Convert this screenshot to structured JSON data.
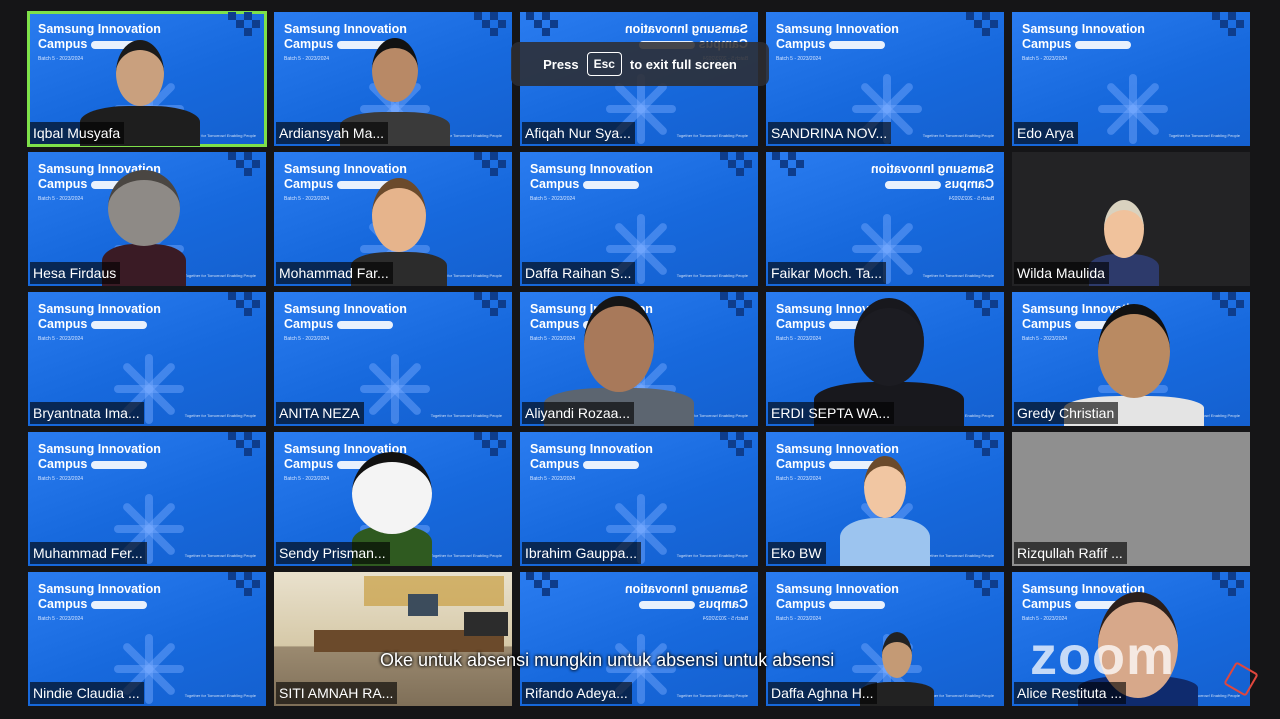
{
  "participants": [
    "Iqbal Musyafa",
    "Ardiansyah Ma...",
    "Afiqah Nur Sya...",
    "SANDRINA NOV...",
    "Edo Arya",
    "Hesa Firdaus",
    "Mohammad Far...",
    "Daffa Raihan S...",
    "Faikar Moch. Ta...",
    "Wilda Maulida",
    "Bryantnata Ima...",
    "ANITA NEZA",
    "Aliyandi Rozaa...",
    "ERDI SEPTA WA...",
    "Gredy Christian",
    "Muhammad Fer...",
    "Sendy Prisman...",
    "Ibrahim Gauppa...",
    "Eko BW",
    "Rizqullah Rafif ...",
    "Nindie Claudia ...",
    "SITI AMNAH RA...",
    "Rifando Adeya...",
    "Daffa Aghna H...",
    "Alice Restituta ..."
  ],
  "slide": {
    "line1": "Samsung Innovation",
    "line2": "Campus",
    "batch": "Batch 5 - 2023/2024",
    "footer": "Together for Tomorrow! Enabling People"
  },
  "fullscreen_banner": {
    "press": "Press",
    "key": "Esc",
    "rest": "to exit full screen"
  },
  "caption": "Oke untuk absensi mungkin untuk absensi untuk absensi",
  "zoom_logo": "zoom",
  "colors": {
    "tile_blue": "#1769dd",
    "active_speaker": "#7ee04a",
    "background": "#151517"
  }
}
